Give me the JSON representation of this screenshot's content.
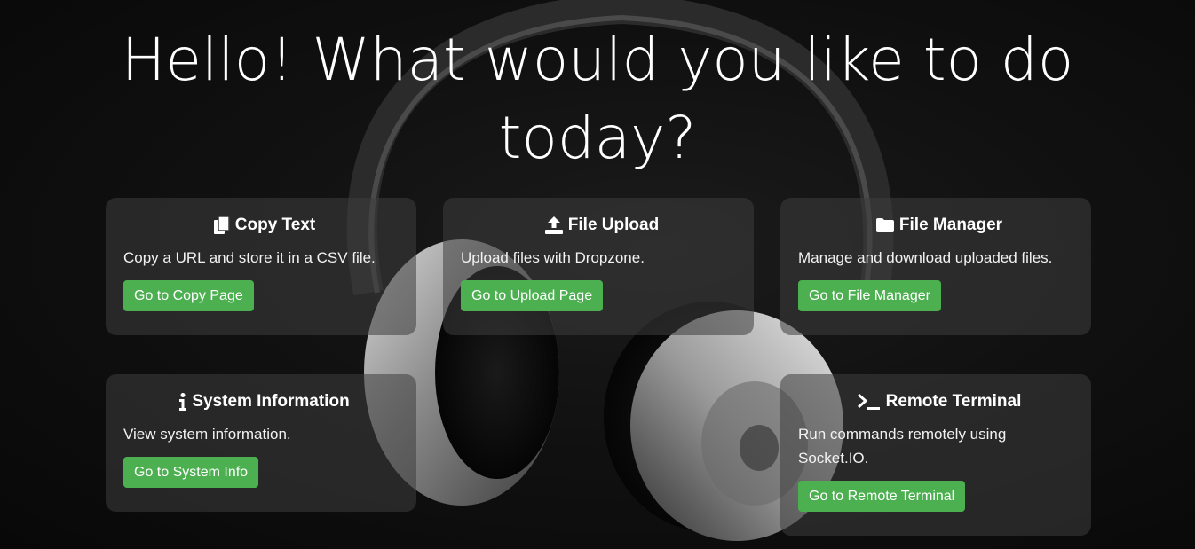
{
  "page": {
    "title_line1": "Hello! What would you like to do",
    "title_line2": "today?"
  },
  "cards": [
    {
      "title": "Copy Text",
      "icon": "copy-icon",
      "description": "Copy a URL and store it in a CSV file.",
      "button": "Go to Copy Page"
    },
    {
      "title": "File Upload",
      "icon": "upload-icon",
      "description": "Upload files with Dropzone.",
      "button": "Go to Upload Page"
    },
    {
      "title": "File Manager",
      "icon": "folder-icon",
      "description": "Manage and download uploaded files.",
      "button": "Go to File Manager"
    },
    {
      "title": "System Information",
      "icon": "info-icon",
      "description": "View system information.",
      "button": "Go to System Info"
    },
    {
      "title": "Remote Terminal",
      "icon": "terminal-icon",
      "description": "Run commands remotely using Socket.IO.",
      "button": "Go to Remote Terminal"
    }
  ],
  "colors": {
    "background": "#0c0c0c",
    "card": "#3e3e3e",
    "button": "#4caf50",
    "text": "#ffffff"
  }
}
